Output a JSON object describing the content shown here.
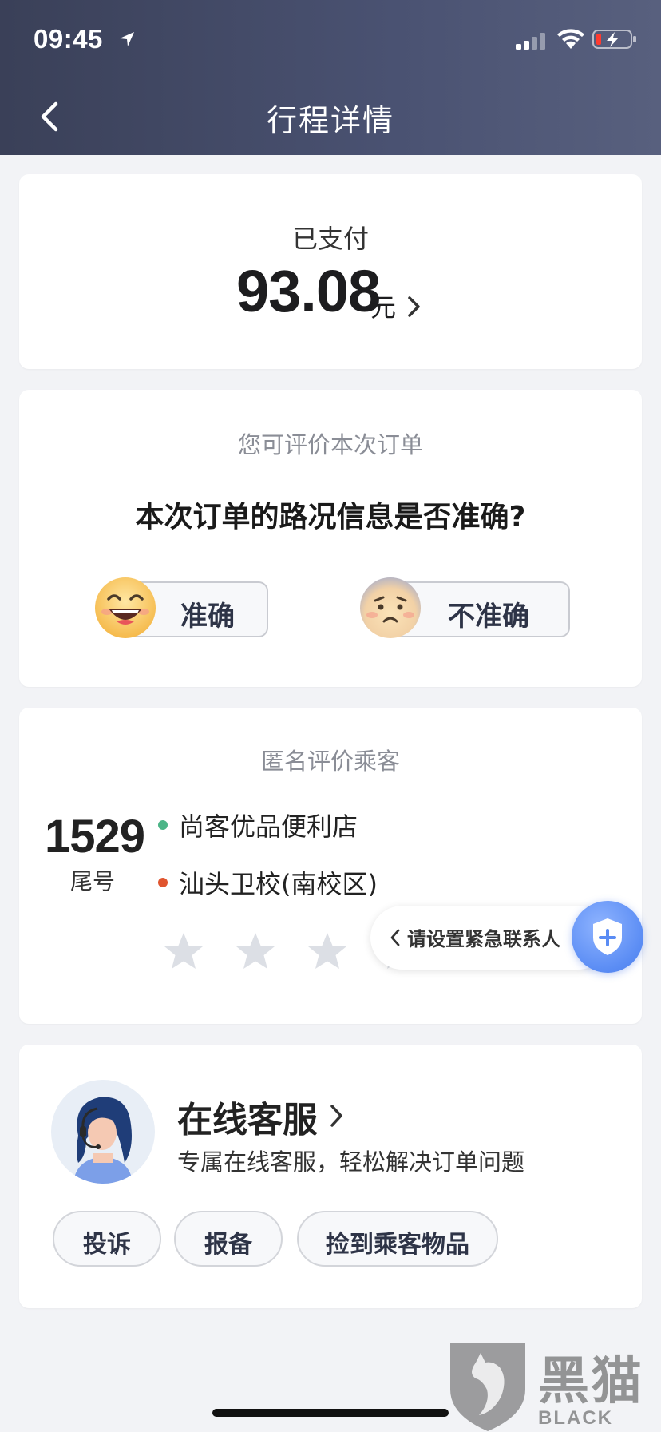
{
  "status_bar": {
    "time": "09:45"
  },
  "nav": {
    "title": "行程详情"
  },
  "payment": {
    "status": "已支付",
    "amount": "93.08",
    "unit": "元"
  },
  "rating": {
    "hint": "您可评价本次订单",
    "question": "本次订单的路况信息是否准确?",
    "accurate_label": "准确",
    "inaccurate_label": "不准确"
  },
  "passenger": {
    "hint": "匿名评价乘客",
    "tail_number": "1529",
    "tail_label": "尾号",
    "start": "尚客优品便利店",
    "end": "汕头卫校(南校区)",
    "stars_total": 5,
    "stars_selected": 0
  },
  "emergency": {
    "label": "请设置紧急联系人"
  },
  "service": {
    "title": "在线客服",
    "description": "专属在线客服，轻松解决订单问题",
    "buttons": [
      "投诉",
      "报备",
      "捡到乘客物品"
    ]
  },
  "watermark": {
    "cn": "黑猫",
    "en": "BLACK CAT"
  },
  "colors": {
    "header_start": "#3a4058",
    "header_end": "#58607e",
    "start_dot": "#4cb587",
    "end_dot": "#e0552f",
    "shield_blue": "#5a8cf4"
  }
}
